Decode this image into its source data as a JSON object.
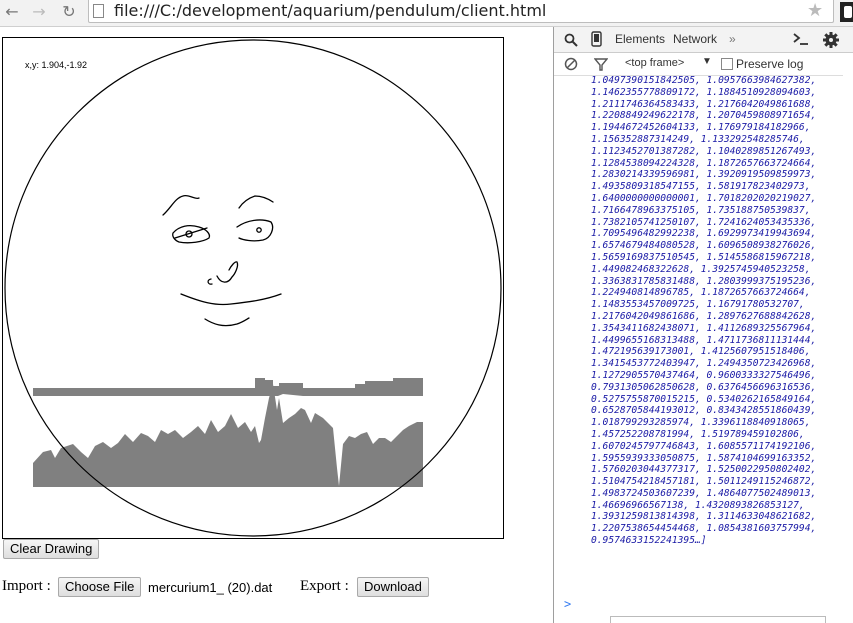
{
  "browser": {
    "url": "file:///C:/development/aquarium/pendulum/client.html",
    "back_icon": "back-arrow-icon",
    "forward_icon": "forward-arrow-icon",
    "reload_icon": "reload-icon"
  },
  "page": {
    "coords": "x,y: 1.904,-1.92",
    "clear_button": "Clear Drawing",
    "import_label": "Import :",
    "choose_file_button": "Choose File",
    "filename": "mercurium1_ (20).dat",
    "export_label": "Export :",
    "download_button": "Download"
  },
  "devtools": {
    "tabs": [
      "Elements",
      "Network"
    ],
    "more": "»",
    "frame": "<top frame>",
    "preserve_log": "Preserve log",
    "prompt": ">",
    "console_lines": [
      "1.0497390151842505, 1.0957663984627382,",
      "1.1462355778809172, 1.1884510928094603,",
      "1.2111746364583433, 1.2176042049861688,",
      "1.2208849249622178, 1.2070459808971654,",
      "1.1944672452604133, 1.176979184182966,",
      "1.156352887314249, 1.133292548285746,",
      "1.1123452701387282, 1.1040289851267493,",
      "1.1284538094224328, 1.1872657663724664,",
      "1.2830214339596981, 1.3920919509859973,",
      "1.4935809318547155, 1.581917823402973,",
      "1.6400000000000001, 1.7018202020219027,",
      "1.7166478963375105, 1.735188750539837,",
      "1.7382105741250107, 1.7241624053435336,",
      "1.7095496482992238, 1.6929973419943694,",
      "1.6574679484080528, 1.6096508938276026,",
      "1.5659169837510545, 1.5145586815967218,",
      "1.449082468322628, 1.3925745940523258,",
      "1.3363831785831488, 1.2803999375195236,",
      "1.224940814896785, 1.1872657663724664,",
      "1.1483553457009725, 1.16791780532707,",
      "1.2176042049861686, 1.2897627688842628,",
      "1.3543411682438071, 1.4112689325567964,",
      "1.4499655168313488, 1.4711736811131444,",
      "1.472195639173001, 1.4125607951518406,",
      "1.3415453772403947, 1.2494350723426968,",
      "1.1272905570437464, 0.9600333327546496,",
      "0.7931305062850628, 0.6376456696316536,",
      "0.5275755870015215, 0.5340262165849164,",
      "0.6528705844193012, 0.8343428551860439,",
      "1.018799293285974, 1.3396118840918065,",
      "1.457252208781994, 1.519789459102806,",
      "1.6070245797746843, 1.6085571174192106,",
      "1.5955939333050875, 1.5874104699163352,",
      "1.5760203044377317, 1.5250022950802402,",
      "1.5104754218457181, 1.5011249115246872,",
      "1.4983724503607239, 1.4864077502489013,",
      "1.46696966567138, 1.4320893826853127,",
      "1.3931259813814398, 1.3114633048621682,",
      "1.2207538654454468, 1.0854381603757994,",
      "0.9574633152241395…]"
    ]
  },
  "chart_data": {
    "type": "area",
    "upper_band": [
      26,
      26,
      26,
      26,
      26,
      26,
      26,
      26,
      26,
      26,
      26,
      26,
      26,
      26,
      26,
      26,
      26,
      26,
      26,
      26,
      26,
      26,
      26,
      26,
      26,
      26,
      26,
      26,
      26,
      26,
      26,
      26,
      26,
      26,
      26,
      26,
      26,
      26,
      26,
      26,
      26,
      26,
      26,
      26,
      26,
      26,
      26,
      26,
      26,
      26,
      26,
      26,
      26,
      26,
      26,
      26,
      26,
      26,
      26,
      26,
      26,
      26,
      26,
      26,
      26,
      26,
      26,
      26,
      26,
      26,
      26,
      26,
      26,
      26,
      26,
      26,
      26,
      26,
      26,
      26,
      26,
      26,
      26,
      26,
      26,
      26,
      26,
      26,
      26,
      26,
      26,
      26,
      26,
      26,
      26,
      26,
      26,
      26,
      26,
      26,
      26,
      26,
      26,
      26,
      26,
      26,
      26,
      26,
      26,
      26,
      26,
      26,
      26,
      26,
      26,
      26,
      26,
      26,
      26,
      26,
      26,
      26,
      26,
      26,
      26,
      26,
      26,
      26,
      26,
      26,
      26,
      26,
      26,
      26,
      26,
      26,
      26,
      26,
      26,
      26,
      26,
      26,
      26,
      26,
      26,
      26,
      26,
      26,
      26,
      26,
      26,
      26,
      26,
      26,
      26,
      26,
      26,
      26,
      26,
      26,
      26,
      26,
      26,
      26,
      26,
      26,
      26,
      26,
      26,
      26,
      26,
      26,
      26,
      26,
      26,
      26,
      26,
      26,
      26,
      26,
      26,
      26,
      26,
      26,
      26,
      26,
      26,
      26,
      26,
      26,
      26,
      26,
      26,
      26,
      26,
      26,
      26,
      26,
      26,
      26,
      26,
      26,
      26,
      26,
      26,
      26,
      26,
      26,
      26,
      26,
      26,
      26,
      26,
      26,
      26,
      26,
      26,
      26,
      26,
      26,
      26,
      26,
      26,
      26,
      26,
      26,
      26,
      26,
      26,
      26,
      26,
      26,
      26,
      26,
      26,
      26,
      26,
      26,
      26,
      26,
      26,
      26,
      26,
      26,
      26,
      26,
      26,
      26,
      26,
      26,
      26,
      26,
      26,
      26,
      26,
      26,
      26,
      26,
      26,
      26,
      26,
      26,
      26,
      26,
      26,
      26,
      26,
      26,
      26,
      26,
      26,
      26,
      26,
      26,
      26,
      26,
      26,
      26,
      26,
      26,
      26,
      26,
      26,
      26,
      26,
      26,
      26,
      26,
      26,
      26,
      26,
      26,
      26,
      26,
      26,
      26,
      26,
      26,
      26,
      26,
      26,
      26,
      26,
      26,
      26,
      26,
      26,
      26,
      26,
      26,
      26,
      26,
      26,
      26,
      26,
      26,
      26,
      26,
      26,
      26,
      26,
      26,
      26,
      26,
      26,
      26,
      26,
      26,
      26,
      26,
      26,
      26,
      26,
      26,
      26,
      26,
      26,
      26,
      26,
      26,
      26,
      26,
      26,
      26,
      26,
      26,
      26,
      26,
      26,
      26,
      26,
      26,
      26,
      26,
      26,
      26,
      26,
      26,
      26,
      26,
      26,
      26,
      26,
      26,
      26,
      26,
      26,
      26,
      26,
      26,
      26,
      26,
      26,
      26,
      26,
      26,
      26,
      26,
      26,
      26,
      26,
      26,
      26,
      26,
      26,
      26,
      26,
      26,
      26,
      26,
      26,
      26,
      26,
      26,
      26,
      26,
      26,
      26,
      26
    ],
    "lower_band": []
  }
}
